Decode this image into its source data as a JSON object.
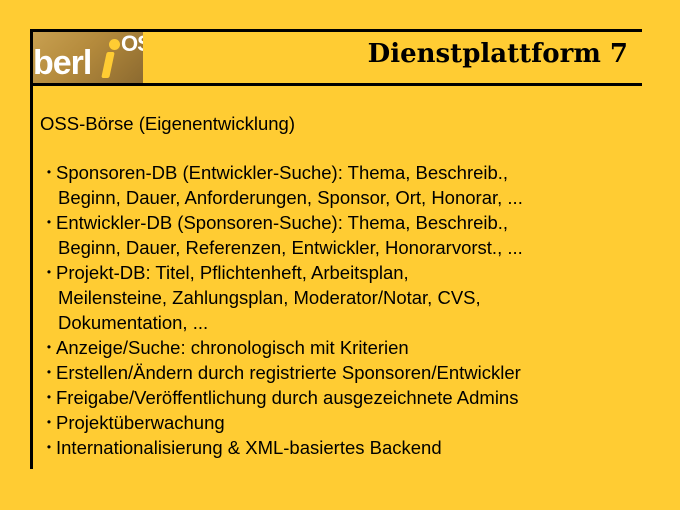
{
  "slide": {
    "title": "Dienstplattform 7",
    "subtitle": "OSS-Börse (Eigenentwicklung)",
    "logo": {
      "text": "berl",
      "superscript": "OS"
    },
    "bullet_symbol": "•",
    "bullets": [
      {
        "lines": [
          "Sponsoren-DB (Entwickler-Suche): Thema, Beschreib.,",
          "Beginn, Dauer, Anforderungen, Sponsor, Ort, Honorar, ..."
        ]
      },
      {
        "lines": [
          "Entwickler-DB (Sponsoren-Suche): Thema, Beschreib.,",
          "Beginn, Dauer, Referenzen, Entwickler, Honorarvorst., ..."
        ]
      },
      {
        "lines": [
          "Projekt-DB: Titel, Pflichtenheft, Arbeitsplan,",
          "Meilensteine, Zahlungsplan, Moderator/Notar, CVS,",
          "Dokumentation, ..."
        ]
      },
      {
        "lines": [
          "Anzeige/Suche: chronologisch mit Kriterien"
        ]
      },
      {
        "lines": [
          "Erstellen/Ändern durch registrierte Sponsoren/Entwickler"
        ]
      },
      {
        "lines": [
          "Freigabe/Veröffentlichung durch ausgezeichnete Admins"
        ]
      },
      {
        "lines": [
          "Projektüberwachung"
        ]
      },
      {
        "lines": [
          "Internationalisierung & XML-basiertes Backend"
        ]
      }
    ],
    "colors": {
      "background": "#ffcc33",
      "frame": "#000000",
      "text": "#000000"
    }
  }
}
